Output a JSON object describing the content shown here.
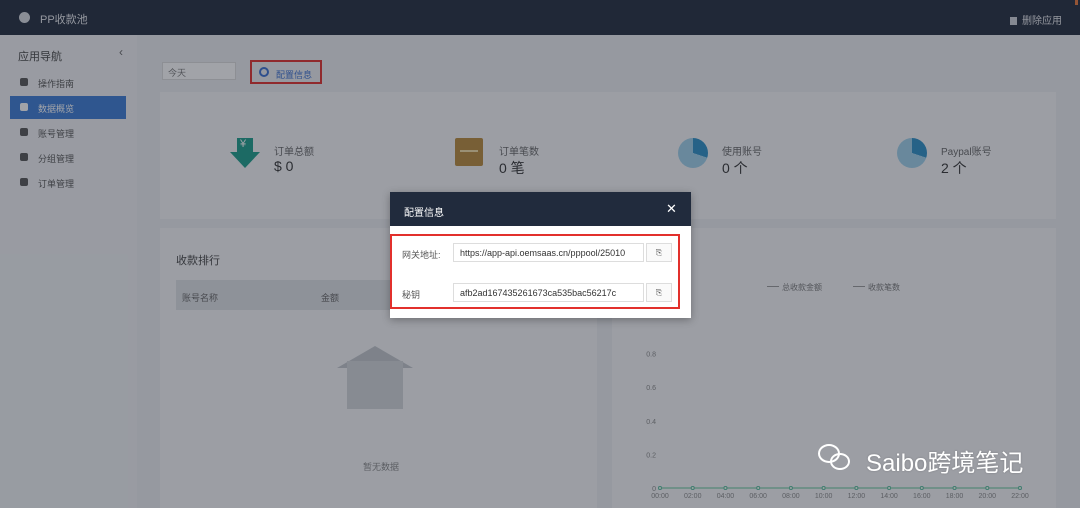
{
  "app": {
    "title": "PP收款池",
    "delete_label": "删除应用"
  },
  "sidebar": {
    "header": "应用导航",
    "collapse_icon": "chevron-left-icon",
    "items": [
      {
        "label": "操作指南",
        "icon": "gear-icon"
      },
      {
        "label": "数据概览",
        "icon": "bar-chart-icon",
        "active": true
      },
      {
        "label": "账号管理",
        "icon": "users-icon"
      },
      {
        "label": "分组管理",
        "icon": "list-icon"
      },
      {
        "label": "订单管理",
        "icon": "orders-icon"
      }
    ]
  },
  "toolbar": {
    "date_value": "今天",
    "config_button": "配置信息"
  },
  "stats": [
    {
      "label": "订单总额",
      "value": "$ 0",
      "icon": "download-yen-icon"
    },
    {
      "label": "订单笔数",
      "value": "0 笔",
      "icon": "box-icon"
    },
    {
      "label": "使用账号",
      "value": "0 个",
      "icon": "pie-icon"
    },
    {
      "label": "Paypal账号",
      "value": "2 个",
      "icon": "pie-icon"
    }
  ],
  "rank": {
    "title": "收款排行",
    "columns": [
      "账号名称",
      "金额"
    ],
    "no_data": "暂无数据"
  },
  "chart": {
    "legend": [
      "总收款金额",
      "收款笔数"
    ],
    "chart_data": {
      "type": "line",
      "x": [
        "00:00",
        "02:00",
        "04:00",
        "06:00",
        "08:00",
        "10:00",
        "12:00",
        "14:00",
        "16:00",
        "18:00",
        "20:00",
        "22:00"
      ],
      "series": [
        {
          "name": "总收款金额",
          "values": [
            0,
            0,
            0,
            0,
            0,
            0,
            0,
            0,
            0,
            0,
            0,
            0
          ]
        },
        {
          "name": "收款笔数",
          "values": [
            0,
            0,
            0,
            0,
            0,
            0,
            0,
            0,
            0,
            0,
            0,
            0
          ]
        }
      ],
      "yticks": [
        "0",
        "0.2",
        "0.4",
        "0.6",
        "0.8"
      ],
      "ylim": [
        0,
        1
      ]
    }
  },
  "modal": {
    "title": "配置信息",
    "close_icon": "close-icon",
    "fields": [
      {
        "label": "网关地址:",
        "value": "https://app-api.oemsaas.cn/pppool/25010",
        "copy": "⎘"
      },
      {
        "label": "秘钥",
        "value": "afb2ad167435261673ca535bac56217c",
        "copy": "⎘"
      }
    ]
  },
  "watermark": "Saibo跨境笔记"
}
